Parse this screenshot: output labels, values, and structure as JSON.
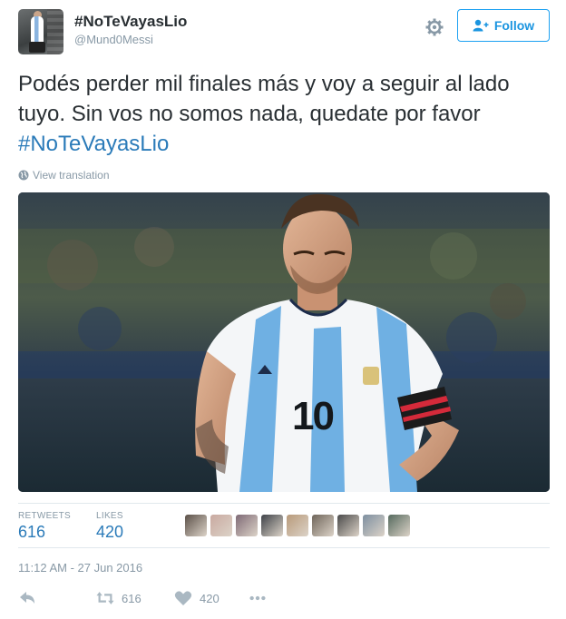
{
  "tweet": {
    "display_name": "#NoTeVayasLio",
    "handle": "@Mund0Messi",
    "text_main": "Podés perder mil finales más y voy a seguir al lado tuyo. Sin vos no somos nada, quedate por favor ",
    "hashtag": "#NoTeVayasLio",
    "view_translation": "View translation",
    "timestamp": "11:12 AM - 27 Jun 2016"
  },
  "header": {
    "follow_label": "Follow",
    "settings_icon": "gear-icon",
    "follow_icon": "add-user-icon"
  },
  "photo": {
    "shirt_number": "10"
  },
  "stats": {
    "retweets_label": "RETWEETS",
    "retweets_value": "616",
    "likes_label": "LIKES",
    "likes_value": "420",
    "liker_colors": [
      "#5b5048",
      "#c9a9a0",
      "#7f6a76",
      "#3e4248",
      "#b89a7a",
      "#6f655a",
      "#4a4a4a",
      "#7d8fa0",
      "#556a5e"
    ]
  },
  "actions": {
    "reply_icon": "reply-icon",
    "retweet_icon": "retweet-icon",
    "retweet_count": "616",
    "like_icon": "heart-icon",
    "like_count": "420",
    "more_icon": "more-icon"
  },
  "colors": {
    "accent": "#1da1f2",
    "link": "#2b7bb9",
    "muted": "#8899a6",
    "text": "#292f33"
  }
}
